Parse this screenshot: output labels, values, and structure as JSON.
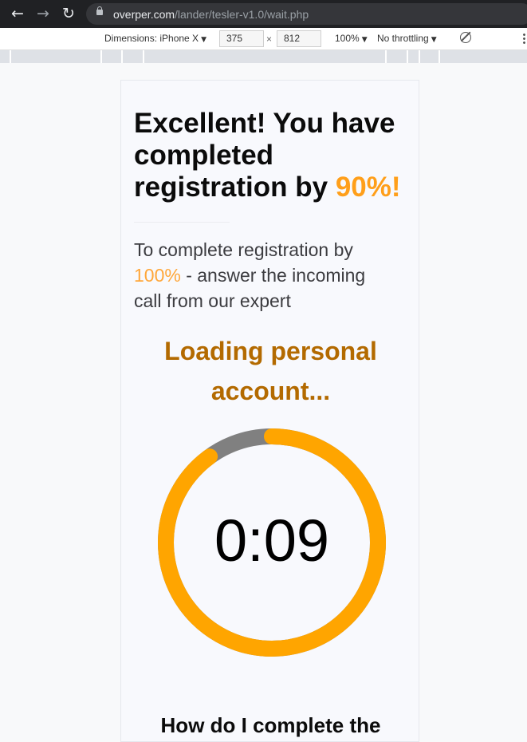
{
  "browser": {
    "url_host": "overper.com",
    "url_path": "/lander/tesler-v1.0/wait.php"
  },
  "device_toolbar": {
    "dimensions_label": "Dimensions: iPhone X",
    "width": "375",
    "height": "812",
    "times_sign": "×",
    "zoom": "100%",
    "throttling": "No throttling"
  },
  "page": {
    "headline_main": "Excellent! You have completed registration by ",
    "headline_percent": "90%!",
    "subtext_before": "To complete registration by ",
    "subtext_percent": "100%",
    "subtext_after": " - answer the incoming call from our expert",
    "loading_text": "Loading personal account...",
    "timer": "0:09",
    "bottom_heading": "How do I complete the"
  },
  "timer_ring": {
    "progress_fraction": 0.9,
    "progress_color": "#ffa500",
    "remaining_color": "#808080"
  }
}
